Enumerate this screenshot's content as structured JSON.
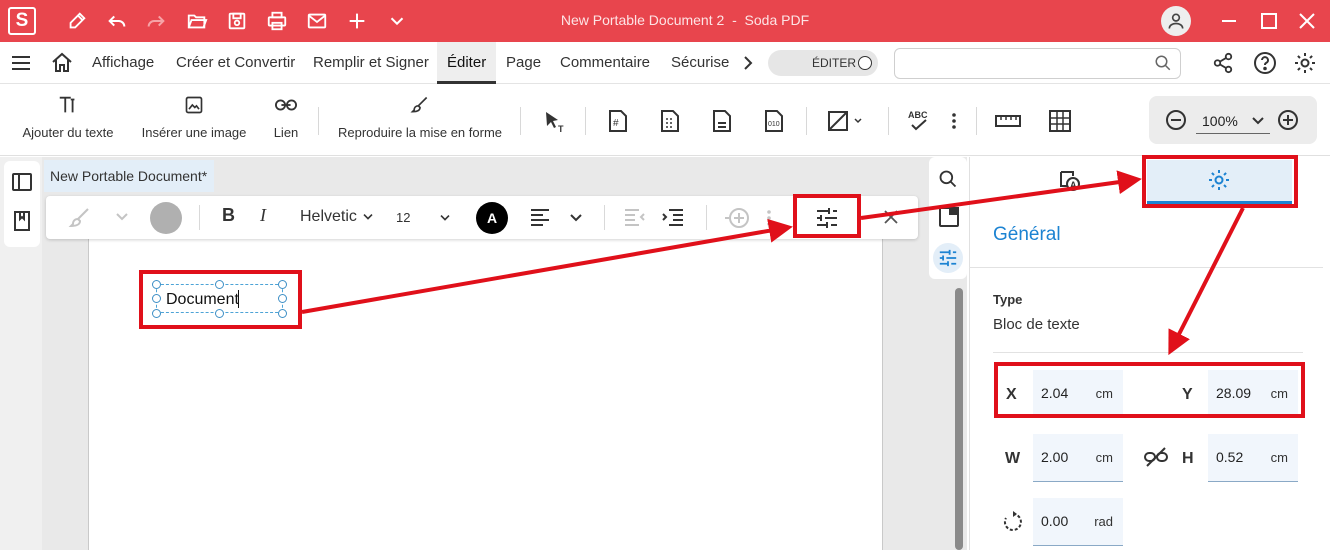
{
  "app": {
    "logo_letter": "S",
    "document_name": "New Portable Document 2",
    "app_name": "Soda PDF"
  },
  "menu": {
    "items": [
      "Affichage",
      "Créer et Convertir",
      "Remplir et Signer",
      "Éditer",
      "Page",
      "Commentaire",
      "Sécurise"
    ],
    "active": "Éditer",
    "edit_toggle_label": "ÉDITER",
    "search_placeholder": ""
  },
  "ribbon": {
    "add_text": "Ajouter du texte",
    "insert_image": "Insérer une image",
    "link": "Lien",
    "format_painter": "Reproduire la mise en forme",
    "spellcheck_badge": "ABC",
    "zoom": "100%"
  },
  "document": {
    "tab_title": "New Portable Document*",
    "text_content": "Document"
  },
  "format_bar": {
    "font": "Helvetic",
    "font_size": "12",
    "color_letter": "A"
  },
  "properties": {
    "section": "Général",
    "type_label": "Type",
    "type_value": "Bloc de texte",
    "x_label": "X",
    "x_value": "2.04",
    "x_unit": "cm",
    "y_label": "Y",
    "y_value": "28.09",
    "y_unit": "cm",
    "w_label": "W",
    "w_value": "2.00",
    "w_unit": "cm",
    "h_label": "H",
    "h_value": "0.52",
    "h_unit": "cm",
    "rotation_value": "0.00",
    "rotation_unit": "rad"
  },
  "colors": {
    "titlebar": "#e8454d",
    "accent_blue": "#1c83d2",
    "annotation_red": "#e0101a"
  },
  "icons": [
    "pen-icon",
    "undo-icon",
    "redo-icon",
    "open-folder-icon",
    "save-icon",
    "print-icon",
    "mail-icon",
    "plus-icon",
    "chevron-down-icon",
    "user-icon",
    "minimize-icon",
    "maximize-icon",
    "close-icon",
    "hamburger-icon",
    "home-icon",
    "share-icon",
    "help-icon",
    "settings-icon",
    "search-icon"
  ]
}
